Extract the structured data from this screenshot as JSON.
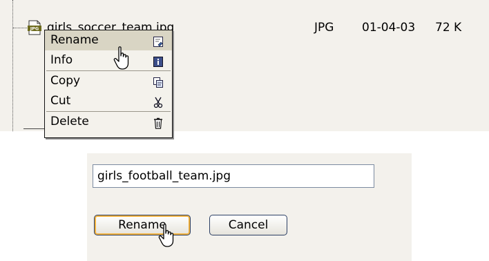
{
  "file": {
    "name": "girls_soccer_team.jpg",
    "type": "JPG",
    "date": "01-04-03",
    "size": "72 K",
    "icon": "jpg-file-icon",
    "icon_badge": "JPG"
  },
  "context_menu": {
    "items": [
      {
        "label": "Rename",
        "icon": "rename-icon"
      },
      {
        "label": "Info",
        "icon": "info-icon"
      },
      {
        "label": "Copy",
        "icon": "copy-icon"
      },
      {
        "label": "Cut",
        "icon": "scissors-icon"
      },
      {
        "label": "Delete",
        "icon": "trash-icon"
      }
    ]
  },
  "rename_dialog": {
    "input_value": "girls_football_team.jpg",
    "rename_label": "Rename",
    "cancel_label": "Cancel"
  },
  "colors": {
    "panel_bg": "#f3f1ec",
    "menu_highlight": "#d9d5c4",
    "button_focus": "#f2b13c",
    "button_border": "#2b3f64"
  }
}
